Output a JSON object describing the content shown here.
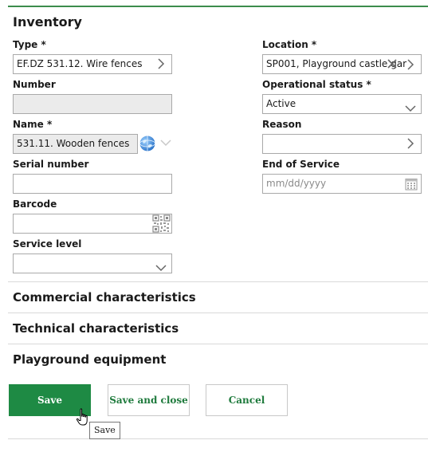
{
  "section_title": "Inventory",
  "left": {
    "type_label": "Type *",
    "type_value": "EF.DZ 531.12. Wire fences",
    "number_label": "Number",
    "number_value": "",
    "name_label": "Name *",
    "name_value": "531.11. Wooden fences",
    "serial_label": "Serial number",
    "serial_value": "",
    "barcode_label": "Barcode",
    "barcode_value": "",
    "service_label": "Service level",
    "service_value": ""
  },
  "right": {
    "location_label": "Location *",
    "location_value": "SP001, Playground castle gar",
    "opstatus_label": "Operational status *",
    "opstatus_value": "Active",
    "reason_label": "Reason",
    "reason_value": "",
    "eos_label": "End of Service",
    "eos_placeholder": "mm/dd/yyyy"
  },
  "sections": {
    "commercial": "Commercial characteristics",
    "technical": "Technical characteristics",
    "playground": "Playground equipment"
  },
  "buttons": {
    "save": "Save",
    "save_close": "Save and close",
    "cancel": "Cancel"
  },
  "tooltip": "Save",
  "colors": {
    "accent": "#1e8a44",
    "top_border": "#3c8c4c"
  },
  "icons": {
    "chevron": "chevron-right-icon",
    "clear": "close-icon",
    "calendar": "calendar-icon",
    "barcode": "qr-code-icon",
    "globe": "globe-icon"
  }
}
